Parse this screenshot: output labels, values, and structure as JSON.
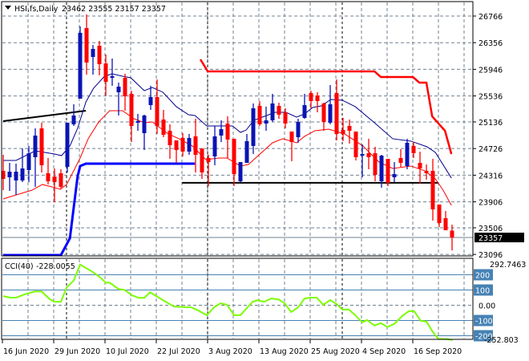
{
  "header": {
    "symbol": "HSI,fs,Daily",
    "ohlc": "23462 23555 23157 23357"
  },
  "indicator": {
    "label": "CCI(40)",
    "value": "-228.0055",
    "max_label": "292.7463",
    "min_label": "-252.803"
  },
  "price_axis": [
    "26766",
    "26356",
    "25946",
    "25536",
    "25136",
    "24726",
    "24316",
    "23906",
    "23506",
    "23096"
  ],
  "current_price": "23357",
  "cci_levels": [
    "200",
    "100",
    "0.00",
    "-100",
    "-200"
  ],
  "date_labels": [
    "16 Jun 2020",
    "29 Jun 2020",
    "10 Jul 2020",
    "22 Jul 2020",
    "3 Aug 2020",
    "13 Aug 2020",
    "25 Aug 2020",
    "4 Sep 2020",
    "16 Sep 2020"
  ],
  "colors": {
    "bull": "#0a14b4",
    "bear": "#ff0000",
    "ma_fast": "#00008b",
    "ma_slow": "#ff0000",
    "cci": "#7cfc00",
    "level": "#4682b4",
    "grid": "#708090"
  },
  "chart_data": {
    "type": "candlestick",
    "title": "HSI,fs,Daily",
    "ylim": [
      23096,
      26766
    ],
    "candles_ohlc": [
      [
        24383,
        24630,
        24086,
        24259
      ],
      [
        24284,
        24506,
        24074,
        24370
      ],
      [
        24235,
        24494,
        24012,
        24370
      ],
      [
        24235,
        24728,
        24210,
        24420
      ],
      [
        24395,
        24766,
        24210,
        24654
      ],
      [
        24593,
        25037,
        24136,
        24926
      ],
      [
        25037,
        25124,
        24358,
        24469
      ],
      [
        24346,
        24580,
        24173,
        24222
      ],
      [
        24296,
        24420,
        23901,
        24210
      ],
      [
        24346,
        24407,
        24111,
        24136
      ],
      [
        24444,
        25124,
        24358,
        25124
      ],
      [
        25099,
        25408,
        25074,
        25235
      ],
      [
        25494,
        26605,
        25494,
        26507
      ],
      [
        26581,
        26791,
        25864,
        26050
      ],
      [
        26136,
        26321,
        25864,
        26260
      ],
      [
        26309,
        26383,
        25852,
        26025
      ],
      [
        26037,
        26173,
        25543,
        25753
      ],
      [
        25815,
        26112,
        25692,
        25840
      ],
      [
        25593,
        25741,
        25235,
        25679
      ],
      [
        25815,
        25877,
        25309,
        25531
      ],
      [
        25568,
        25617,
        24827,
        25074
      ],
      [
        25124,
        25259,
        25000,
        25148
      ],
      [
        24963,
        25247,
        24704,
        25235
      ],
      [
        25395,
        25692,
        25321,
        25519
      ],
      [
        25519,
        25790,
        24951,
        25074
      ],
      [
        25173,
        25321,
        24901,
        24938
      ],
      [
        25000,
        25099,
        24568,
        24778
      ],
      [
        24852,
        24852,
        24506,
        24704
      ],
      [
        24889,
        24963,
        24605,
        24679
      ],
      [
        24679,
        24951,
        24630,
        24889
      ],
      [
        24914,
        25185,
        24358,
        24630
      ],
      [
        24728,
        24728,
        24259,
        24358
      ],
      [
        24580,
        24630,
        24148,
        24518
      ],
      [
        24605,
        25074,
        24469,
        24914
      ],
      [
        24926,
        25161,
        24827,
        25025
      ],
      [
        25111,
        25222,
        24580,
        24864
      ],
      [
        24877,
        24877,
        24148,
        24333
      ],
      [
        24222,
        24518,
        24210,
        24518
      ],
      [
        24506,
        24951,
        24506,
        24840
      ],
      [
        24766,
        25420,
        24642,
        25346
      ],
      [
        25383,
        25457,
        25074,
        25099
      ],
      [
        25111,
        25371,
        25000,
        25161
      ],
      [
        25161,
        25568,
        25136,
        25420
      ],
      [
        25383,
        25432,
        25185,
        25247
      ],
      [
        25284,
        25346,
        25037,
        25111
      ],
      [
        24988,
        24988,
        24531,
        24827
      ],
      [
        24901,
        25185,
        24815,
        25136
      ],
      [
        25198,
        25568,
        25185,
        25395
      ],
      [
        25580,
        25617,
        25346,
        25457
      ],
      [
        25543,
        25593,
        25284,
        25457
      ],
      [
        25420,
        25432,
        25000,
        25136
      ],
      [
        25124,
        25704,
        25099,
        25408
      ],
      [
        25580,
        25790,
        24852,
        24951
      ],
      [
        25012,
        25198,
        24840,
        24951
      ],
      [
        25074,
        25173,
        24802,
        25000
      ],
      [
        24988,
        24988,
        24543,
        24593
      ],
      [
        24617,
        24790,
        24284,
        24642
      ],
      [
        24654,
        24877,
        24407,
        24593
      ],
      [
        24654,
        24753,
        24222,
        24321
      ],
      [
        24222,
        24630,
        24124,
        24617
      ],
      [
        24568,
        24568,
        24148,
        24198
      ],
      [
        24284,
        24518,
        24210,
        24333
      ],
      [
        24580,
        24716,
        24444,
        24506
      ],
      [
        24457,
        24877,
        24407,
        24815
      ],
      [
        24766,
        24827,
        24580,
        24654
      ],
      [
        24506,
        24679,
        24185,
        24420
      ],
      [
        24383,
        24481,
        24247,
        24346
      ],
      [
        24383,
        24568,
        23617,
        23790
      ],
      [
        23864,
        23864,
        23518,
        23580
      ],
      [
        23654,
        23765,
        23469,
        23469
      ],
      [
        23462,
        23555,
        23157,
        23357
      ]
    ],
    "ma_fast": [
      [
        0,
        24543
      ],
      [
        2,
        24543
      ],
      [
        5,
        24691
      ],
      [
        8,
        24642
      ],
      [
        9.1,
        24617
      ],
      [
        10.4,
        24766
      ],
      [
        11.6,
        25037
      ],
      [
        12.9,
        25445
      ],
      [
        14.1,
        25655
      ],
      [
        15.8,
        25840
      ],
      [
        17,
        25877
      ],
      [
        18.6,
        25840
      ],
      [
        19.9,
        25815
      ],
      [
        22,
        25617
      ],
      [
        23.25,
        25667
      ],
      [
        24.9,
        25593
      ],
      [
        27,
        25371
      ],
      [
        28.9,
        25247
      ],
      [
        29.9,
        25235
      ],
      [
        31.75,
        25074
      ],
      [
        34.1,
        25074
      ],
      [
        35.75,
        25074
      ],
      [
        37,
        24975
      ],
      [
        37.9,
        25012
      ],
      [
        39.1,
        25161
      ],
      [
        40.75,
        25222
      ],
      [
        42.4,
        25284
      ],
      [
        44.1,
        25284
      ],
      [
        45.75,
        25210
      ],
      [
        47,
        25259
      ],
      [
        48.25,
        25358
      ],
      [
        49.6,
        25383
      ],
      [
        51.1,
        25482
      ],
      [
        52.9,
        25470
      ],
      [
        54.9,
        25371
      ],
      [
        57.9,
        25124
      ],
      [
        60.75,
        24877
      ],
      [
        63.6,
        24840
      ],
      [
        66.1,
        24753
      ],
      [
        67.4,
        24667
      ],
      [
        69.9,
        24272
      ]
    ],
    "ma_slow": [
      [
        0,
        23950
      ],
      [
        2,
        24012
      ],
      [
        4.5,
        24086
      ],
      [
        6.1,
        24173
      ],
      [
        7.6,
        24136
      ],
      [
        8.9,
        24099
      ],
      [
        9.9,
        24173
      ],
      [
        12,
        24580
      ],
      [
        13.25,
        24877
      ],
      [
        14.9,
        25136
      ],
      [
        16.6,
        25309
      ],
      [
        18.6,
        25309
      ],
      [
        20.4,
        25185
      ],
      [
        22,
        25124
      ],
      [
        23.25,
        25136
      ],
      [
        25.75,
        24951
      ],
      [
        27.4,
        24877
      ],
      [
        29.5,
        24766
      ],
      [
        31.6,
        24556
      ],
      [
        33.6,
        24580
      ],
      [
        34.9,
        24580
      ],
      [
        37,
        24457
      ],
      [
        38.25,
        24481
      ],
      [
        39.9,
        24630
      ],
      [
        42,
        24815
      ],
      [
        43.6,
        24877
      ],
      [
        45.75,
        24815
      ],
      [
        47,
        24914
      ],
      [
        48.6,
        25000
      ],
      [
        50.75,
        25025
      ],
      [
        53.25,
        24951
      ],
      [
        56.1,
        24766
      ],
      [
        58.6,
        24518
      ],
      [
        60.75,
        24420
      ],
      [
        63.6,
        24457
      ],
      [
        65.75,
        24383
      ],
      [
        67.4,
        24259
      ],
      [
        68.6,
        24086
      ],
      [
        69.9,
        23851
      ]
    ],
    "upper_band": [
      [
        30.75,
        26099
      ],
      [
        31.9,
        25914
      ],
      [
        57.9,
        25914
      ],
      [
        58.9,
        25827
      ],
      [
        63.9,
        25827
      ],
      [
        64.9,
        25741
      ],
      [
        66,
        25741
      ],
      [
        66.9,
        25222
      ],
      [
        68.9,
        25000
      ],
      [
        69.9,
        24642
      ]
    ],
    "lower_step": [
      [
        0,
        23086
      ],
      [
        9,
        23086
      ],
      [
        10.4,
        23345
      ],
      [
        11.6,
        24296
      ],
      [
        12,
        24457
      ],
      [
        12.9,
        24494
      ],
      [
        29.9,
        24494
      ]
    ],
    "trendline": [
      [
        0,
        25148
      ],
      [
        12.9,
        25309
      ]
    ],
    "support_line": [
      [
        27.9,
        24198
      ],
      [
        67.9,
        24198
      ]
    ],
    "cci": [
      [
        0,
        60
      ],
      [
        1.1,
        50
      ],
      [
        2,
        50
      ],
      [
        3.25,
        70
      ],
      [
        4.9,
        90
      ],
      [
        6,
        90
      ],
      [
        7.25,
        40
      ],
      [
        8,
        23
      ],
      [
        9,
        23
      ],
      [
        9.9,
        117
      ],
      [
        11,
        163
      ],
      [
        12,
        267
      ],
      [
        13.9,
        220
      ],
      [
        15.1,
        184
      ],
      [
        16,
        148
      ],
      [
        16.6,
        148
      ],
      [
        18,
        106
      ],
      [
        18.9,
        101
      ],
      [
        20.1,
        65
      ],
      [
        21.1,
        49
      ],
      [
        22,
        49
      ],
      [
        22.9,
        85
      ],
      [
        24.5,
        44
      ],
      [
        26.6,
        -8
      ],
      [
        28.6,
        -13
      ],
      [
        29.25,
        -13
      ],
      [
        30.4,
        -34
      ],
      [
        31.75,
        -65
      ],
      [
        32.9,
        -13
      ],
      [
        33.9,
        13
      ],
      [
        34.9,
        3
      ],
      [
        36,
        -65
      ],
      [
        37,
        -65
      ],
      [
        38.9,
        23
      ],
      [
        39.75,
        34
      ],
      [
        40,
        29
      ],
      [
        40.75,
        23
      ],
      [
        41.75,
        44
      ],
      [
        42.9,
        39
      ],
      [
        43.9,
        13
      ],
      [
        44.9,
        -45
      ],
      [
        46,
        -13
      ],
      [
        47,
        44
      ],
      [
        47.9,
        50
      ],
      [
        48.9,
        50
      ],
      [
        49.9,
        3
      ],
      [
        51,
        34
      ],
      [
        52,
        8
      ],
      [
        52.9,
        -28
      ],
      [
        53.9,
        -28
      ],
      [
        54.9,
        -65
      ],
      [
        56,
        -112
      ],
      [
        56.75,
        -97
      ],
      [
        57.9,
        -133
      ],
      [
        58.9,
        -117
      ],
      [
        59.9,
        -143
      ],
      [
        61,
        -122
      ],
      [
        62.25,
        -70
      ],
      [
        63.25,
        -39
      ],
      [
        64.1,
        -39
      ],
      [
        65.1,
        -102
      ],
      [
        66,
        -107
      ],
      [
        67,
        -175
      ],
      [
        67.9,
        -222
      ],
      [
        69.1,
        -222
      ],
      [
        70.1,
        -228
      ]
    ],
    "cci_range": [
      -252.803,
      292.7463
    ]
  }
}
